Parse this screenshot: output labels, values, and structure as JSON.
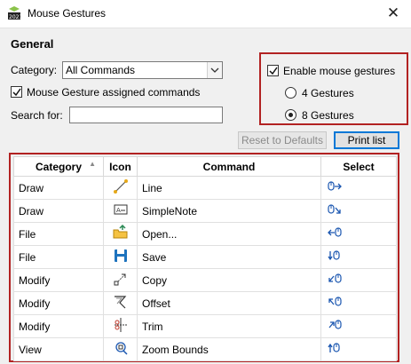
{
  "window": {
    "title": "Mouse Gestures"
  },
  "general": {
    "heading": "General",
    "category_label": "Category:",
    "category_value": "All Commands",
    "assigned_label": "Mouse Gesture assigned commands",
    "search_label": "Search for:",
    "search_value": ""
  },
  "gestures": {
    "enable_label": "Enable mouse gestures",
    "option4": "4 Gestures",
    "option8": "8 Gestures",
    "selected": "8 Gestures"
  },
  "buttons": {
    "reset": "Reset to Defaults",
    "print": "Print list"
  },
  "table": {
    "headers": {
      "category": "Category",
      "icon": "Icon",
      "command": "Command",
      "select": "Select"
    },
    "rows": [
      {
        "category": "Draw",
        "icon": "line-icon",
        "command": "Line",
        "gesture": "right"
      },
      {
        "category": "Draw",
        "icon": "simplenote-icon",
        "command": "SimpleNote",
        "gesture": "down-right"
      },
      {
        "category": "File",
        "icon": "open-folder-icon",
        "command": "Open...",
        "gesture": "left"
      },
      {
        "category": "File",
        "icon": "save-icon",
        "command": "Save",
        "gesture": "down"
      },
      {
        "category": "Modify",
        "icon": "copy-icon",
        "command": "Copy",
        "gesture": "down-left"
      },
      {
        "category": "Modify",
        "icon": "offset-icon",
        "command": "Offset",
        "gesture": "up-left"
      },
      {
        "category": "Modify",
        "icon": "trim-icon",
        "command": "Trim",
        "gesture": "up-right"
      },
      {
        "category": "View",
        "icon": "zoom-bounds-icon",
        "command": "Zoom Bounds",
        "gesture": "up"
      }
    ]
  },
  "colors": {
    "highlight_border": "#b22222",
    "accent": "#0078d7",
    "panel": "#f0f0f0"
  }
}
